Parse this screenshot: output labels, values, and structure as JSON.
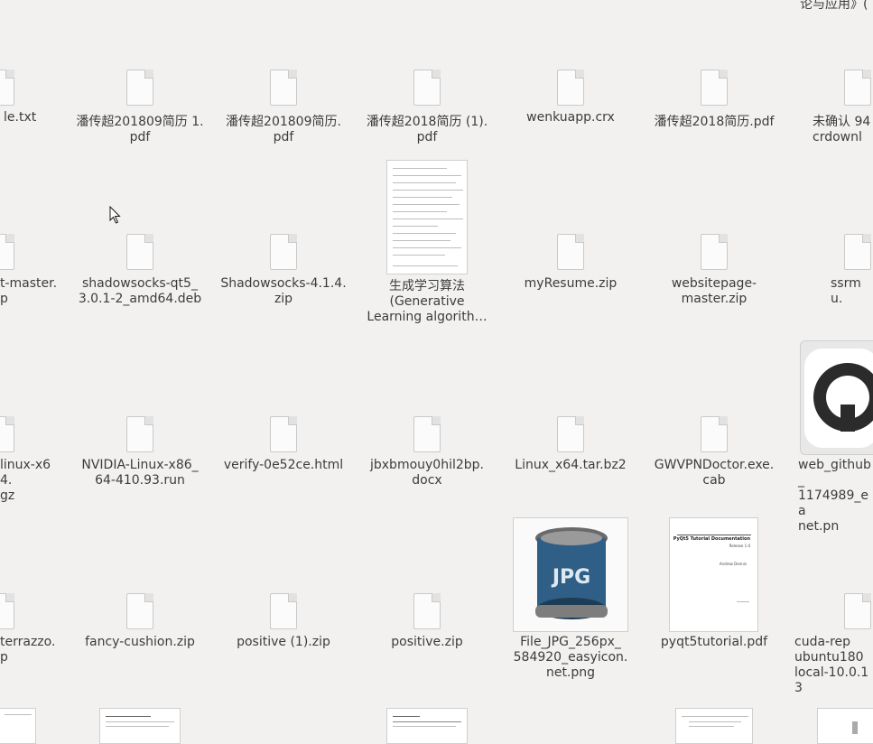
{
  "top_partial_label": "论与应用》(",
  "rows": [
    [
      "le.txt",
      "潘传超201809简历 1.\npdf",
      "潘传超201809简历.\npdf",
      "潘传超2018简历 (1).\npdf",
      "wenkuapp.crx",
      "潘传超2018简历.pdf",
      "未确认 94\ncrdownl"
    ],
    [
      "t-master.\np",
      "shadowsocks-qt5_\n3.0.1-2_amd64.deb",
      "Shadowsocks-4.1.4.\nzip",
      "生成学习算法\n(Generative\nLearning algorith…",
      "myResume.zip",
      "websitepage-\nmaster.zip",
      "ssrmu."
    ],
    [
      "linux-x64.\ngz",
      "NVIDIA-Linux-x86_\n64-410.93.run",
      "verify-0e52ce.html",
      "jbxbmouy0hil2bp.\ndocx",
      "Linux_x64.tar.bz2",
      "GWVPNDoctor.exe.\ncab",
      "web_github_\n1174989_ea\nnet.pn"
    ],
    [
      "terrazzo.\np",
      "fancy-cushion.zip",
      "positive (1).zip",
      "positive.zip",
      "File_JPG_256px_\n584920_easyicon.\nnet.png",
      "pyqt5tutorial.pdf",
      "cuda-rep\nubuntu180\nlocal-10.0.13"
    ]
  ],
  "thumb_texts": {
    "pdf_title": "PyQt5 Tutorial Documentation",
    "pdf_release": "Release 1.0",
    "pdf_author": "Andrew Dennis",
    "jpg_text": "JPG"
  }
}
